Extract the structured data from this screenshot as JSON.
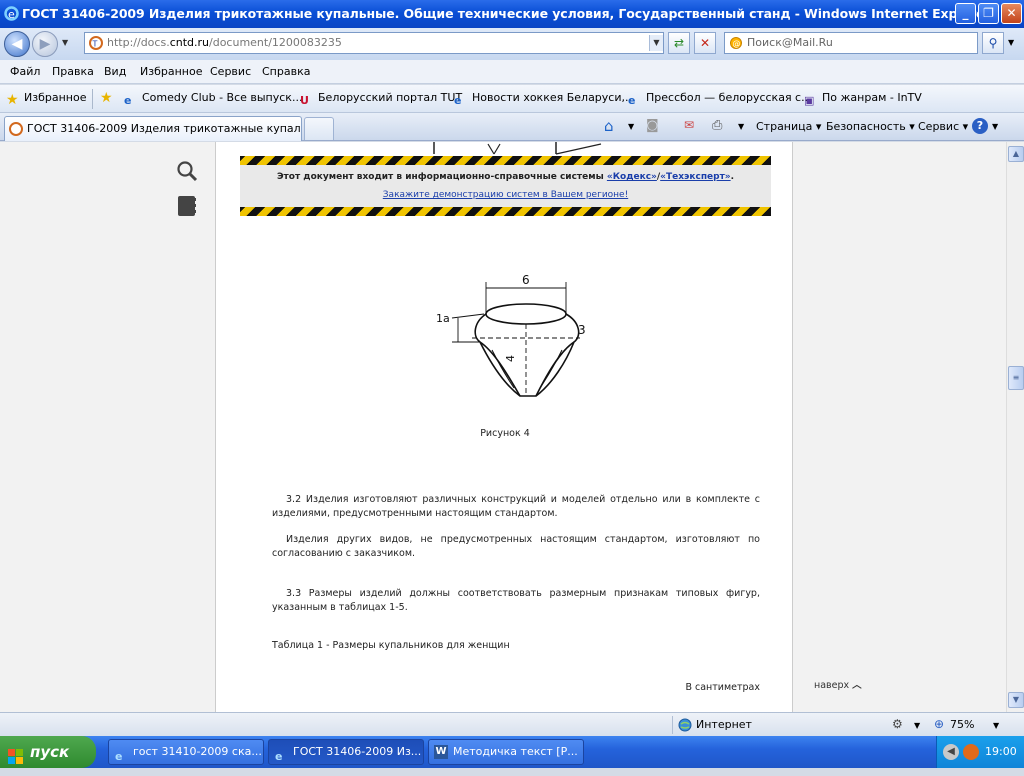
{
  "window": {
    "title": "ГОСТ 31406-2009 Изделия трикотажные купальные. Общие технические условия, Государственный станд - Windows Internet Explorer",
    "minimize": "_",
    "maximize": "❐",
    "close": "✕"
  },
  "nav": {
    "url_prefix": "http://docs.",
    "url_host": "cntd.ru",
    "url_path": "/document/1200083235",
    "search_placeholder": "Поиск@Mail.Ru"
  },
  "menu": [
    "Файл",
    "Правка",
    "Вид",
    "Избранное",
    "Сервис",
    "Справка"
  ],
  "favorites": {
    "label": "Избранное",
    "links": [
      "Comedy Club - Все выпуск...",
      "Белорусский портал TUT",
      "Новости хоккея Беларуси,...",
      "Прессбол — белорусская с...",
      "По жанрам - InTV"
    ]
  },
  "tab": {
    "title": "ГОСТ 31406-2009 Изделия трикотажные купальн..."
  },
  "commands": {
    "page": "Страница",
    "safety": "Безопасность",
    "tools": "Сервис"
  },
  "banner": {
    "line1_prefix": "Этот документ входит в информационно-справочные системы",
    "kodeks": "«Кодекс»",
    "sep": "/",
    "techexpert": "«Техэксперт»",
    "dot": ".",
    "line2": "Закажите демонстрацию систем в Вашем регионе!"
  },
  "figure": {
    "label_6": "6",
    "label_1a": "1а",
    "label_3": "3",
    "label_4": "4",
    "caption": "Рисунок 4"
  },
  "text": {
    "p1": "3.2 Изделия изготовляют различных конструкций и моделей отдельно или в комплекте с изделиями, предусмотренными настоящим стандартом.",
    "p2": "Изделия других видов, не предусмотренных настоящим стандартом, изготовляют по согласованию с заказчиком.",
    "p3": "3.3 Размеры изделий должны соответствовать размерным признакам типовых фигур, указанным в таблицах 1-5.",
    "table_title": "Таблица 1 - Размеры купальников для женщин",
    "units": "В сантиметрах"
  },
  "totop": "наверх",
  "status": {
    "zone": "Интернет",
    "zoom": "75%"
  },
  "taskbar": {
    "start": "пуск",
    "items": [
      "гост 31410-2009 ска...",
      "ГОСТ 31406-2009 Из...",
      "Методичка текст [Р..."
    ],
    "clock": "19:00"
  },
  "colors": {
    "title_blue": "#0a4fd6",
    "link_blue": "#1a3eaa",
    "stripe_yellow": "#f0c400",
    "start_green": "#2f8a2f"
  }
}
